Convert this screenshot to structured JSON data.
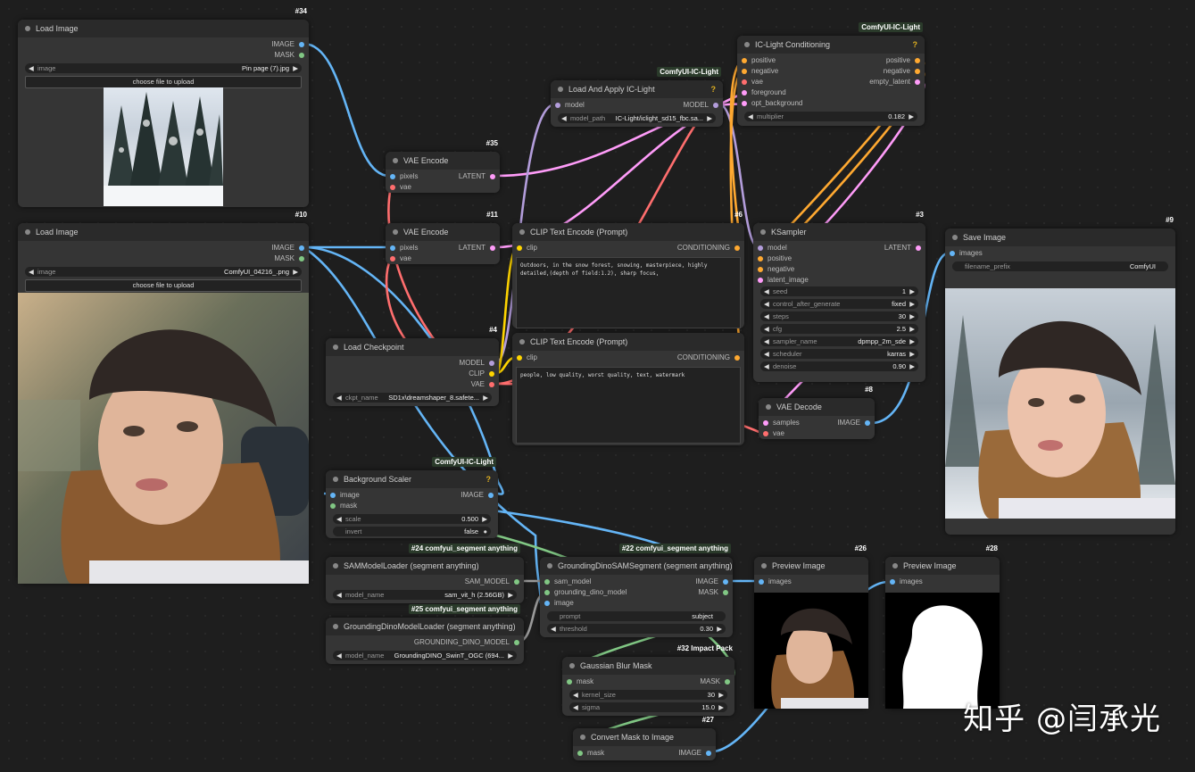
{
  "colors": {
    "image": "#64b5f6",
    "mask": "#81c784",
    "latent": "#ff9cf9",
    "model": "#b39ddb",
    "clip": "#ffd500",
    "vae": "#ff6e6e",
    "conditioning": "#ffa931",
    "sam": "#9a9a9a"
  },
  "nodes": {
    "load_image_34": {
      "id": "#34",
      "title": "Load Image",
      "out_image": "IMAGE",
      "out_mask": "MASK",
      "widget_label": "image",
      "widget_value": "Pin page (7).jpg",
      "upload": "choose file to upload",
      "preview_desc": "snowy forest"
    },
    "load_image_10": {
      "id": "#10",
      "title": "Load Image",
      "out_image": "IMAGE",
      "out_mask": "MASK",
      "widget_label": "image",
      "widget_value": "ComfyUI_04216_.png",
      "upload": "choose file to upload"
    },
    "vae_encode_35": {
      "id": "#35",
      "title": "VAE Encode",
      "in_pixels": "pixels",
      "in_vae": "vae",
      "out_latent": "LATENT"
    },
    "vae_encode_11": {
      "id": "#11",
      "title": "VAE Encode",
      "in_pixels": "pixels",
      "in_vae": "vae",
      "out_latent": "LATENT"
    },
    "load_apply_iclight": {
      "tag": "ComfyUI-IC-Light",
      "title": "Load And Apply IC-Light",
      "help": "?",
      "in_model": "model",
      "out_model": "MODEL",
      "widget_label": "model_path",
      "widget_value": "IC-Light/iclight_sd15_fbc.sa..."
    },
    "iclight_conditioning": {
      "tag": "ComfyUI-IC-Light",
      "title": "IC-Light Conditioning",
      "help": "?",
      "in_positive": "positive",
      "in_negative": "negative",
      "in_vae": "vae",
      "in_foreground": "foreground",
      "in_opt_background": "opt_background",
      "out_positive": "positive",
      "out_negative": "negative",
      "out_empty_latent": "empty_latent",
      "widget_label": "multiplier",
      "widget_value": "0.182"
    },
    "clip_text_6": {
      "id": "#6",
      "title": "CLIP Text Encode (Prompt)",
      "in_clip": "clip",
      "out_conditioning": "CONDITIONING",
      "text": "Outdoors, in the snow forest, snowing, masterpiece, highly detailed,(depth of field:1.2), sharp focus,"
    },
    "clip_text_7": {
      "title": "CLIP Text Encode (Prompt)",
      "in_clip": "clip",
      "out_conditioning": "CONDITIONING",
      "text": "people, low quality, worst quality, text, watermark"
    },
    "load_checkpoint": {
      "id": "#4",
      "title": "Load Checkpoint",
      "out_model": "MODEL",
      "out_clip": "CLIP",
      "out_vae": "VAE",
      "widget_label": "ckpt_name",
      "widget_value": "SD1x\\dreamshaper_8.safete..."
    },
    "ksampler": {
      "id": "#3",
      "title": "KSampler",
      "in_model": "model",
      "in_positive": "positive",
      "in_negative": "negative",
      "in_latent": "latent_image",
      "out_latent": "LATENT",
      "widgets": [
        {
          "label": "seed",
          "value": "1"
        },
        {
          "label": "control_after_generate",
          "value": "fixed"
        },
        {
          "label": "steps",
          "value": "30"
        },
        {
          "label": "cfg",
          "value": "2.5"
        },
        {
          "label": "sampler_name",
          "value": "dpmpp_2m_sde"
        },
        {
          "label": "scheduler",
          "value": "karras"
        },
        {
          "label": "denoise",
          "value": "0.90"
        }
      ]
    },
    "vae_decode": {
      "id": "#8",
      "title": "VAE Decode",
      "in_samples": "samples",
      "in_vae": "vae",
      "out_image": "IMAGE"
    },
    "save_image": {
      "id": "#9",
      "title": "Save Image",
      "in_images": "images",
      "widget_label": "filename_prefix",
      "widget_value": "ComfyUI"
    },
    "background_scaler": {
      "tag": "ComfyUI-IC-Light",
      "title": "Background Scaler",
      "help": "?",
      "in_image": "image",
      "in_mask": "mask",
      "out_image": "IMAGE",
      "w_scale_label": "scale",
      "w_scale_value": "0.500",
      "w_invert_label": "invert",
      "w_invert_value": "false"
    },
    "sam_loader": {
      "tag_id": "#24",
      "tag": "comfyui_segment anything",
      "title": "SAMModelLoader (segment anything)",
      "out": "SAM_MODEL",
      "widget_label": "model_name",
      "widget_value": "sam_vit_h (2.56GB)"
    },
    "gdino_loader": {
      "tag_id": "#25",
      "tag": "comfyui_segment anything",
      "title": "GroundingDinoModelLoader (segment anything)",
      "out": "GROUNDING_DINO_MODEL",
      "widget_label": "model_name",
      "widget_value": "GroundingDINO_SwinT_OGC (694..."
    },
    "gdino_sam_segment": {
      "tag_id": "#22",
      "tag": "comfyui_segment anything",
      "title": "GroundingDinoSAMSegment (segment anything)",
      "in_sam": "sam_model",
      "in_gdino": "grounding_dino_model",
      "in_image": "image",
      "out_image": "IMAGE",
      "out_mask": "MASK",
      "w_prompt_label": "prompt",
      "w_prompt_value": "subject",
      "w_threshold_label": "threshold",
      "w_threshold_value": "0.30"
    },
    "preview_26": {
      "id": "#26",
      "title": "Preview Image",
      "in_images": "images"
    },
    "preview_28": {
      "id": "#28",
      "title": "Preview Image",
      "in_images": "images"
    },
    "gaussian_blur": {
      "id": "#32",
      "tag": "Impact Pack",
      "title": "Gaussian Blur Mask",
      "in_mask": "mask",
      "out_mask": "MASK",
      "w_kernel_label": "kernel_size",
      "w_kernel_value": "30",
      "w_sigma_label": "sigma",
      "w_sigma_value": "15.0"
    },
    "convert_mask": {
      "id": "#27",
      "title": "Convert Mask to Image",
      "in_mask": "mask",
      "out_image": "IMAGE"
    }
  },
  "watermark": "知乎 @闫承光"
}
